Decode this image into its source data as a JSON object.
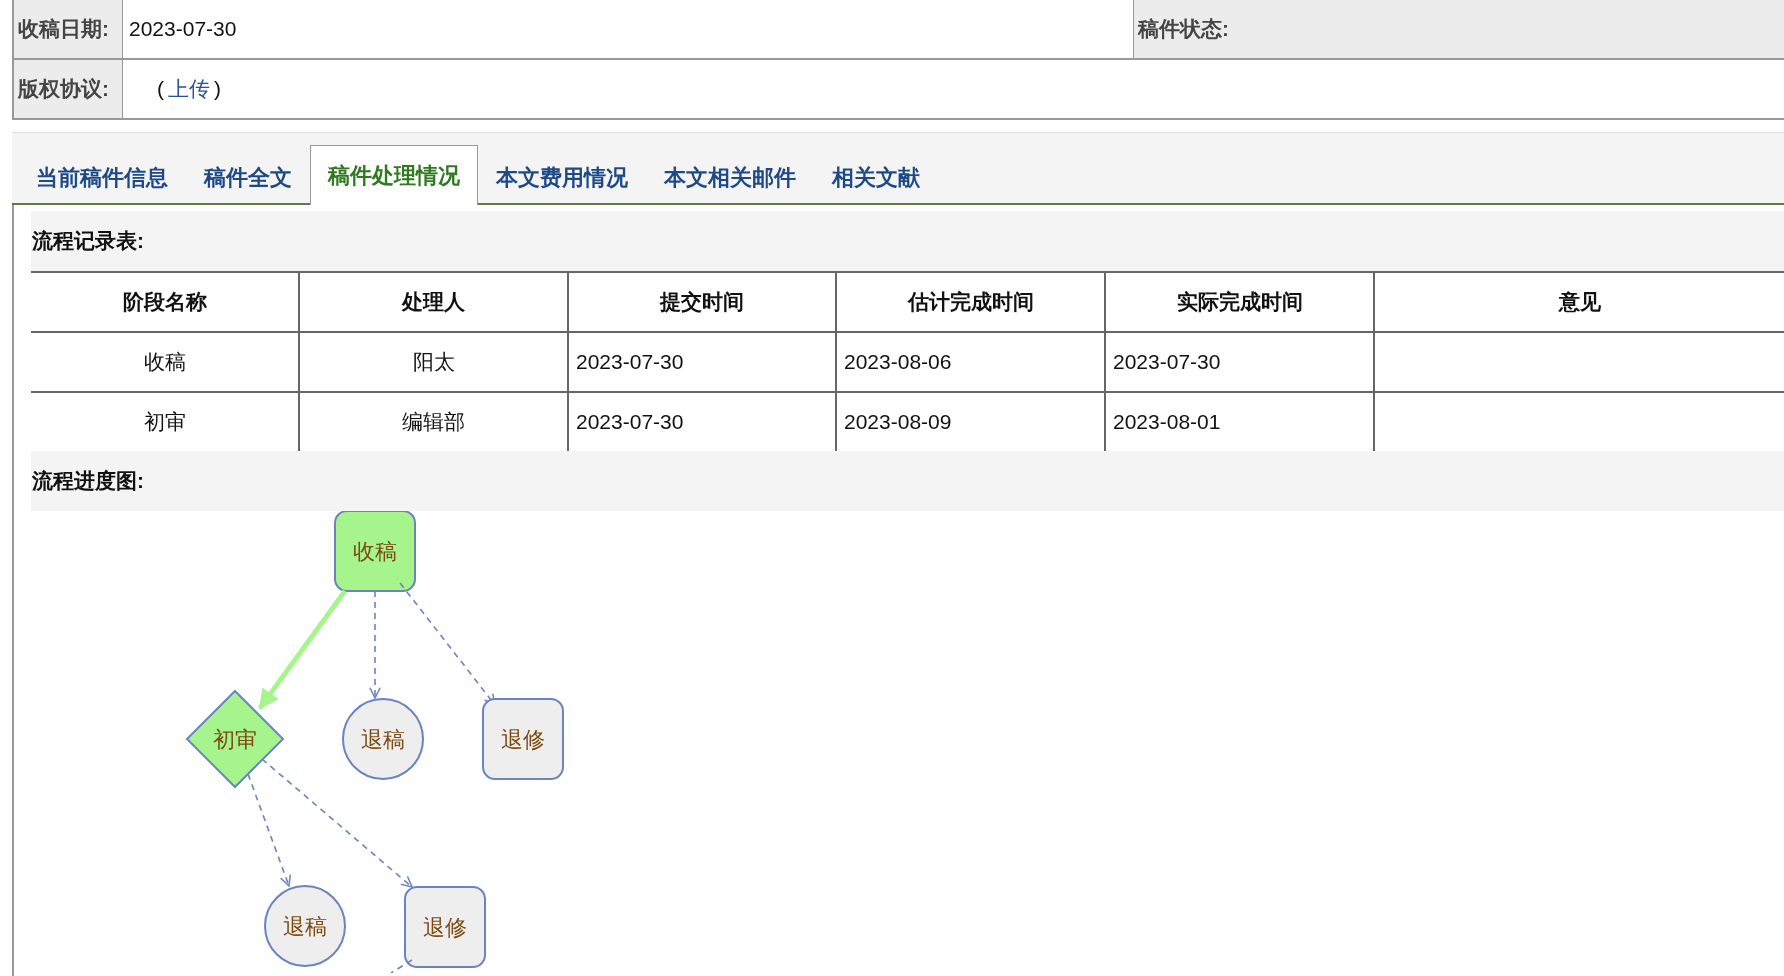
{
  "form": {
    "received_label": "收稿日期:",
    "received_value": "2023-07-30",
    "status_label": "稿件状态:",
    "agreement_label": "版权协议:",
    "agreement_prefix": "(",
    "agreement_link": "上传",
    "agreement_suffix": ")"
  },
  "tabs": [
    {
      "label": "当前稿件信息",
      "selected": false
    },
    {
      "label": "稿件全文",
      "selected": false
    },
    {
      "label": "稿件处理情况",
      "selected": true
    },
    {
      "label": "本文费用情况",
      "selected": false
    },
    {
      "label": "本文相关邮件",
      "selected": false
    },
    {
      "label": "相关文献",
      "selected": false
    }
  ],
  "record_title": "流程记录表:",
  "table": {
    "columns": [
      "阶段名称",
      "处理人",
      "提交时间",
      "估计完成时间",
      "实际完成时间",
      "意见"
    ],
    "rows": [
      [
        "收稿",
        "阳太",
        "2023-07-30",
        "2023-08-06",
        "2023-07-30",
        ""
      ],
      [
        "初审",
        "编辑部",
        "2023-07-30",
        "2023-08-09",
        "2023-08-01",
        ""
      ]
    ]
  },
  "diagram_title": "流程进度图:",
  "flow": {
    "label": "收稿",
    "kind": "rounded",
    "reached": true,
    "children": [
      {
        "label": "初审",
        "kind": "diamond",
        "reached": true,
        "children": [
          {
            "label": "退稿",
            "kind": "circle",
            "reached": false
          },
          {
            "label": "退修",
            "kind": "rounded",
            "reached": false
          }
        ]
      },
      {
        "label": "退稿",
        "kind": "circle",
        "reached": false
      },
      {
        "label": "退修",
        "kind": "rounded",
        "reached": false
      }
    ]
  }
}
